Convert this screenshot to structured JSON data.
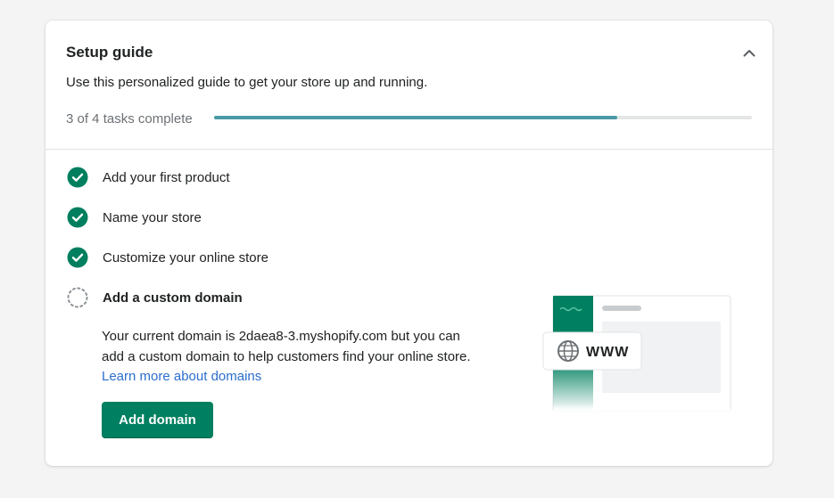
{
  "setup_guide": {
    "title": "Setup guide",
    "subtitle": "Use this personalized guide to get your store up and running.",
    "progress": {
      "label": "3 of 4 tasks complete",
      "completed": 3,
      "total": 4,
      "fill_fraction": 0.75
    },
    "tasks": [
      {
        "label": "Add your first product",
        "status": "complete"
      },
      {
        "label": "Name your store",
        "status": "complete"
      },
      {
        "label": "Customize your online store",
        "status": "complete"
      },
      {
        "label": "Add a custom domain",
        "status": "active"
      }
    ],
    "active_task": {
      "description_text": "Your current domain is 2daea8-3.myshopify.com but you can add a custom domain to help customers find your online store.",
      "link_text": "Learn more about domains",
      "button_label": "Add domain"
    },
    "illustration": {
      "badge_text": "WWW"
    }
  },
  "colors": {
    "check": "#007f5f",
    "primary_button": "#008060",
    "progress_fill": "#4a9aa5",
    "link": "#2c6ecb"
  }
}
